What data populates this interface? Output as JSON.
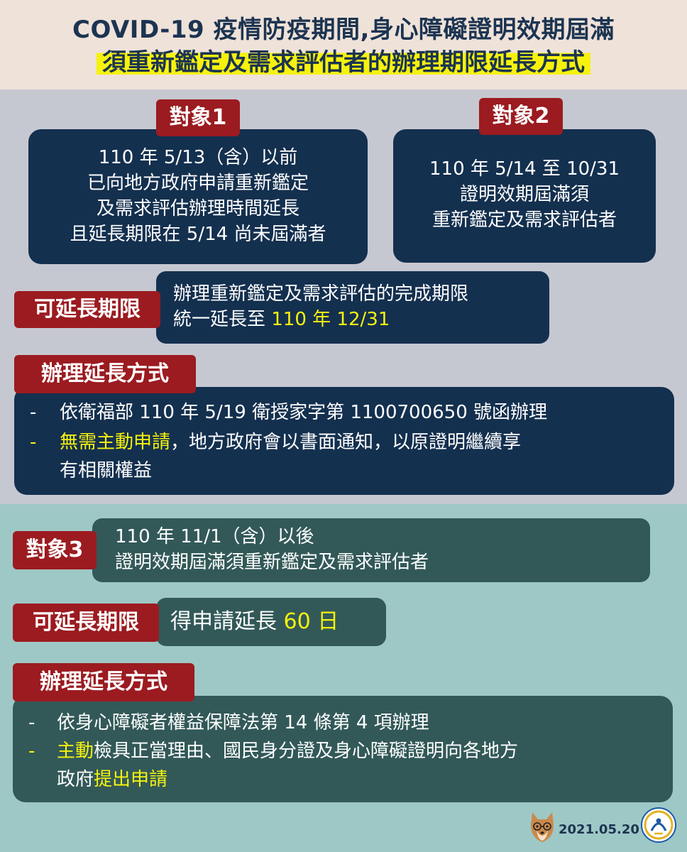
{
  "header": {
    "title_line1": "COVID-19 疫情防疫期間,身心障礙證明效期屆滿",
    "title_line2": "須重新鑑定及需求評估者的辦理期限延長方式"
  },
  "target1": {
    "tag": "對象1",
    "lines": [
      "110 年 5/13（含）以前",
      "已向地方政府申請重新鑑定",
      "及需求評估辦理時間延長",
      "且延長期限在 5/14 尚未屆滿者"
    ]
  },
  "target2": {
    "tag": "對象2",
    "lines": [
      "110 年 5/14 至 10/31",
      "證明效期屆滿須",
      "重新鑑定及需求評估者"
    ]
  },
  "extend1": {
    "tag": "可延長期限",
    "line1": "辦理重新鑑定及需求評估的完成期限",
    "line2_prefix": "統一延長至 ",
    "line2_highlight": "110 年 12/31"
  },
  "method1": {
    "tag": "辦理延長方式",
    "bullet1": "依衛福部 110 年 5/19 衛授家字第 1100700650 號函辦理",
    "bullet2_highlight": "無需主動申請",
    "bullet2_rest": "，地方政府會以書面通知，以原證明繼續享",
    "bullet2_cont": "有相關權益"
  },
  "target3": {
    "tag": "對象3",
    "line1": "110 年 11/1（含）以後",
    "line2": "證明效期屆滿須重新鑑定及需求評估者"
  },
  "extend2": {
    "tag": "可延長期限",
    "prefix": "得申請延長 ",
    "highlight": "60 日"
  },
  "method2": {
    "tag": "辦理延長方式",
    "bullet1": "依身心障礙者權益保障法第 14 條第 4 項辦理",
    "bullet2_highlight": "主動",
    "bullet2_rest": "檢具正當理由、國民身分證及身心障礙證明向各地方",
    "bullet2_cont_prefix": "政府",
    "bullet2_cont_highlight": "提出申請"
  },
  "bullet_symbol": "-",
  "footer": {
    "date": "2021.05.20"
  },
  "icons": {
    "dog": "shiba-dog-icon",
    "logo": "ministry-logo-icon"
  },
  "colors": {
    "navy": "#14304f",
    "red_tag": "#9b1b20",
    "highlight": "#f6f20e",
    "teal_box": "#325958"
  }
}
